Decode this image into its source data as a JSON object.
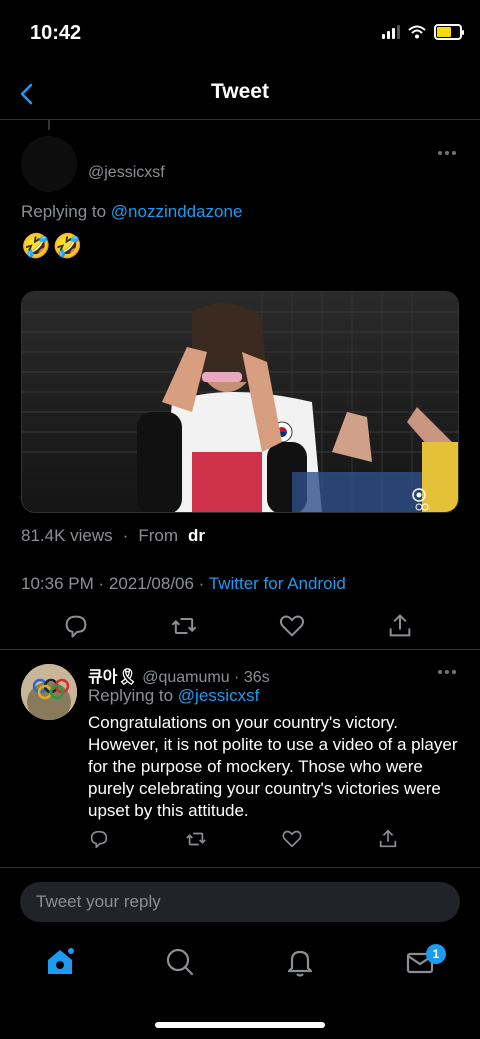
{
  "status_bar": {
    "time": "10:42"
  },
  "nav": {
    "title": "Tweet"
  },
  "tweet": {
    "username": "@jessicxsf",
    "replying_prefix": "Replying to",
    "replying_to": "@nozzinddazone",
    "emojis": "🤣🤣",
    "views": "81.4K views",
    "separator": "·",
    "from_label": "From",
    "from_name": "dr",
    "time": "10:36 PM · 2021/08/06 · ",
    "client": "Twitter for Android"
  },
  "reply": {
    "display_name": "큐아🎗",
    "handle": "@quamumu",
    "age": " · 36s",
    "replying_prefix": "Replying to",
    "replying_to": "@jessicxsf",
    "text": "Congratulations on your country's victory. However, it is not polite to use a video of a player for the purpose of mockery. Those who were purely celebrating your country's victories were upset by this attitude."
  },
  "compose": {
    "placeholder": "Tweet your reply"
  },
  "tabs": {
    "messages_badge": "1"
  },
  "colors": {
    "accent": "#1d9bf0",
    "background": "#000000",
    "muted": "#8b8f94"
  },
  "icons": [
    "back-arrow-icon",
    "more-icon",
    "reply-icon",
    "retweet-icon",
    "like-icon",
    "share-icon",
    "home-icon",
    "search-icon",
    "bell-icon",
    "mail-icon"
  ]
}
